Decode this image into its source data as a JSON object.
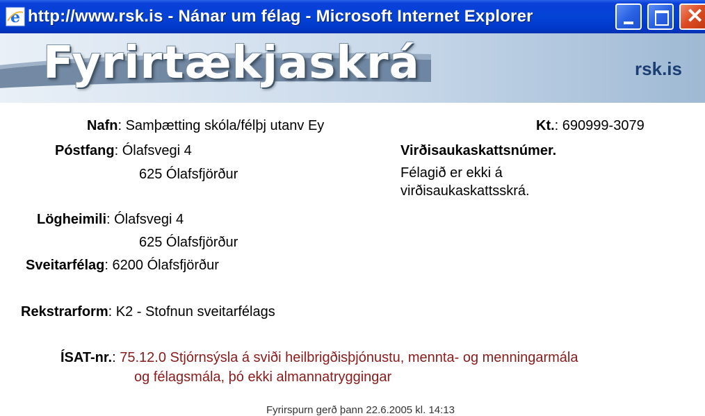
{
  "window": {
    "title": "http://www.rsk.is - Nánar um félag - Microsoft Internet Explorer"
  },
  "banner": {
    "logo": "Fyrirtækjaskrá",
    "link": "rsk.is"
  },
  "company": {
    "name_label": "Nafn",
    "name": "Samþætting skóla/félþj utanv Ey",
    "kt_label": "Kt.",
    "kt": "690999-3079",
    "postfang_label": "Póstfang",
    "postfang_line1": "Ólafsvegi 4",
    "postfang_line2": "625 Ólafsfjörður",
    "vsk_label": "Virðisaukaskattsnúmer.",
    "vsk_line1": "Félagið er ekki á",
    "vsk_line2": "virðisaukaskattsskrá.",
    "logheimili_label": "Lögheimili",
    "logheimili_line1": "Ólafsvegi 4",
    "logheimili_line2": "625 Ólafsfjörður",
    "sveitarfelag_label": "Sveitarfélag",
    "sveitarfelag": "6200 Ólafsfjörður",
    "rekstrarform_label": "Rekstrarform",
    "rekstrarform": "K2 - Stofnun sveitarfélags",
    "isat_label": "ÍSAT-nr.",
    "isat_line1": "75.12.0 Stjórnsýsla á sviði heilbrigðisþjónustu, mennta- og menningarmála",
    "isat_line2": "og félagsmála, þó ekki almannatryggingar"
  },
  "footer": {
    "text": "Fyrirspurn gerð þann 22.6.2005 kl. 14:13"
  }
}
